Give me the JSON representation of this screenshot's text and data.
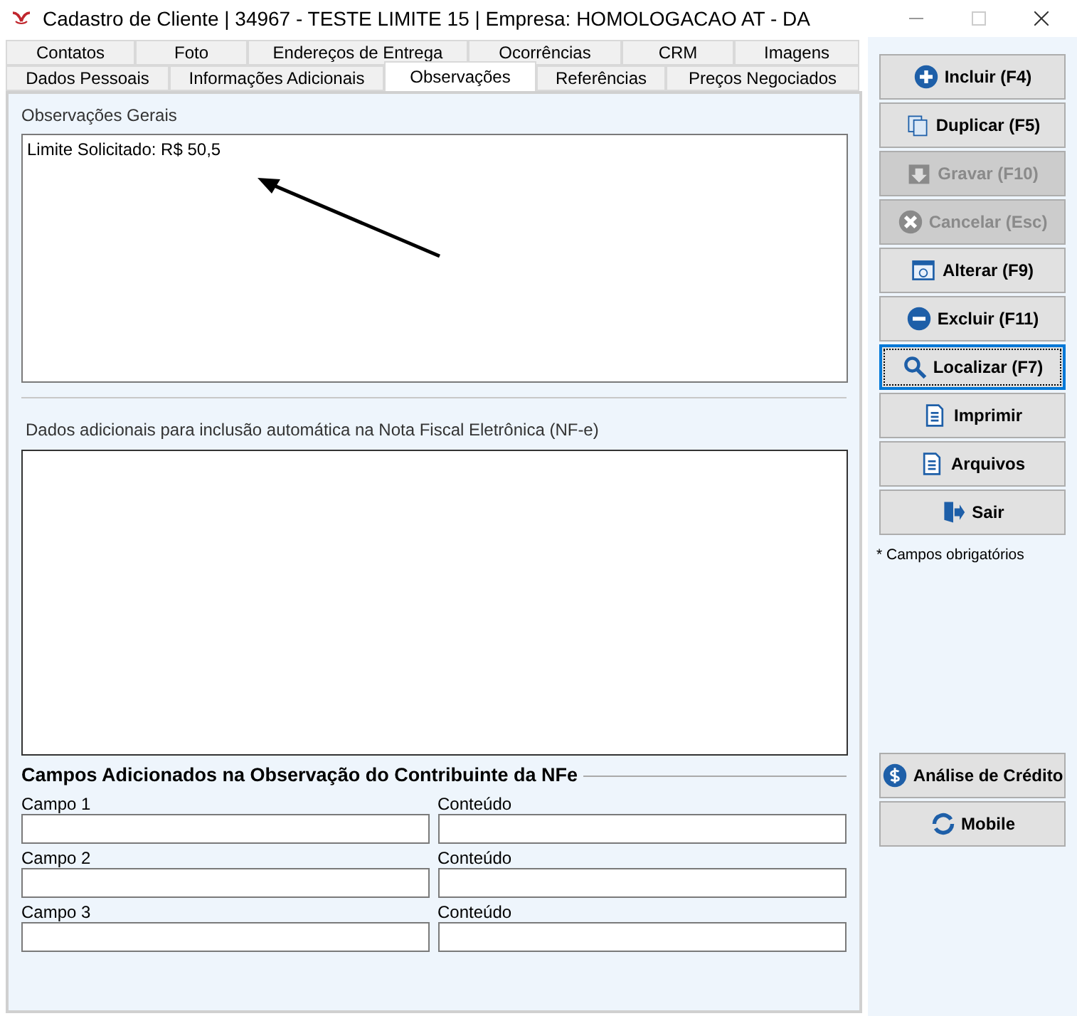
{
  "window": {
    "title": "Cadastro de Cliente | 34967 - TESTE LIMITE 15 | Empresa: HOMOLOGACAO AT - DA"
  },
  "tabs_back": [
    {
      "label": "Contatos",
      "selected": false
    },
    {
      "label": "Foto",
      "selected": false
    },
    {
      "label": "Endereços de Entrega",
      "selected": false
    },
    {
      "label": "Ocorrências",
      "selected": false
    },
    {
      "label": "CRM",
      "selected": false
    },
    {
      "label": "Imagens",
      "selected": false
    }
  ],
  "tabs_front": [
    {
      "label": "Dados Pessoais",
      "selected": false
    },
    {
      "label": "Informações Adicionais",
      "selected": false
    },
    {
      "label": "Observações",
      "selected": true
    },
    {
      "label": "Referências",
      "selected": false
    },
    {
      "label": "Preços Negociados",
      "selected": false
    }
  ],
  "observacoes_gerais": {
    "label": "Observações Gerais",
    "value": "Limite Solicitado: R$ 50,5"
  },
  "dados_adicionais": {
    "label": "Dados adicionais para inclusão automática na Nota Fiscal Eletrônica (NF-e)"
  },
  "campos_section": {
    "title": "Campos Adicionados na Observação do Contribuinte da NFe",
    "rows": [
      {
        "campo_label": "Campo 1",
        "conteudo_label": "Conteúdo"
      },
      {
        "campo_label": "Campo 2",
        "conteudo_label": "Conteúdo"
      },
      {
        "campo_label": "Campo 3",
        "conteudo_label": "Conteúdo"
      }
    ]
  },
  "actions": [
    {
      "label": "Incluir (F4)",
      "disabled": false,
      "focused": false
    },
    {
      "label": "Duplicar (F5)",
      "disabled": false,
      "focused": false
    },
    {
      "label": "Gravar (F10)",
      "disabled": true,
      "focused": false
    },
    {
      "label": "Cancelar (Esc)",
      "disabled": true,
      "focused": false
    },
    {
      "label": "Alterar (F9)",
      "disabled": false,
      "focused": false
    },
    {
      "label": "Excluir (F11)",
      "disabled": false,
      "focused": false
    },
    {
      "label": "Localizar (F7)",
      "disabled": false,
      "focused": true
    },
    {
      "label": "Imprimir",
      "disabled": false,
      "focused": false
    },
    {
      "label": "Arquivos",
      "disabled": false,
      "focused": false
    },
    {
      "label": "Sair",
      "disabled": false,
      "focused": false
    }
  ],
  "required_note": "* Campos obrigatórios",
  "extra_actions": [
    {
      "label": "Análise de Crédito",
      "disabled": false
    },
    {
      "label": "Mobile",
      "disabled": false
    }
  ]
}
